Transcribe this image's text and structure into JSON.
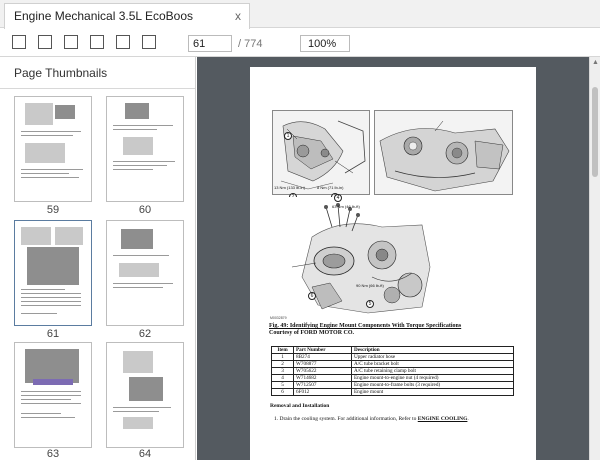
{
  "tab": {
    "title": "Engine Mechanical 3.5L EcoBoos",
    "close_glyph": "x"
  },
  "toolbar": {
    "buttons": [
      "sidebar-toggle-icon",
      "zoom-out-icon",
      "zoom-in-icon",
      "rotate-icon",
      "print-icon",
      "download-icon"
    ],
    "page_current": "61",
    "page_total": "/ 774",
    "zoom": "100%"
  },
  "sidebar": {
    "title": "Page Thumbnails",
    "thumbnails": [
      {
        "label": "59",
        "selected": false
      },
      {
        "label": "60",
        "selected": false
      },
      {
        "label": "61",
        "selected": true
      },
      {
        "label": "62",
        "selected": false
      },
      {
        "label": "63",
        "selected": false
      },
      {
        "label": "64",
        "selected": false
      }
    ]
  },
  "document": {
    "figure_id": "M0032879",
    "callouts": {
      "c1": "1",
      "c2": "2",
      "c3": "3",
      "c4": "4",
      "c5": "5",
      "c6": "6",
      "t1": "13 Nm (133 lb-in)",
      "t2": "8 Nm (71 lb-in)",
      "t3": "63 Nm (46 lb-ft)",
      "t4": "90 Nm (66 lb-ft)"
    },
    "caption_line1": "Fig. 49: Identifying Engine Mount Components With Torque Specifications",
    "caption_line2": "Courtesy of FORD MOTOR CO.",
    "table": {
      "headers": [
        "Item",
        "Part Number",
        "Description"
      ],
      "rows": [
        [
          "1",
          "8B274",
          "Upper radiator hose"
        ],
        [
          "2",
          "W708877",
          "A/C tube bracket bolt"
        ],
        [
          "3",
          "W705622",
          "A/C tube retaining clamp bolt"
        ],
        [
          "4",
          "W714682",
          "Engine mount-to-engine nut (4 required)"
        ],
        [
          "5",
          "W712507",
          "Engine mount-to-frame bolts (3 required)"
        ],
        [
          "6",
          "6F012",
          "Engine mount"
        ]
      ]
    },
    "section_heading": "Removal and Installation",
    "step1_text": "1.   Drain the cooling system. For additional information, Refer to",
    "step1_link": "ENGINE COOLING",
    "step1_end": "."
  },
  "colors": {
    "viewer_bg": "#545a60",
    "selected_border": "#5b7ca0",
    "thumb_band": "#7c6bb3"
  }
}
